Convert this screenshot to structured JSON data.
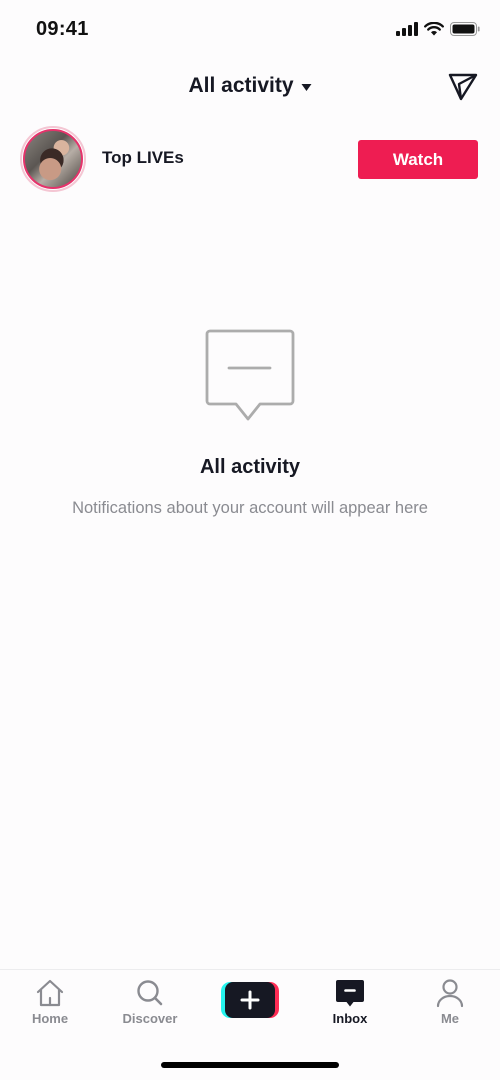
{
  "status_bar": {
    "time": "09:41",
    "icons": [
      "cellular-signal-icon",
      "wifi-icon",
      "battery-icon"
    ]
  },
  "header": {
    "title": "All activity",
    "title_dropdown_icon": "caret-down-icon",
    "action_icon": "send-direct-message-icon"
  },
  "live_row": {
    "avatar_icon": "live-user-avatar",
    "label": "Top LIVEs",
    "button_label": "Watch"
  },
  "empty_state": {
    "icon": "empty-message-icon",
    "title": "All activity",
    "subtitle": "Notifications about your account will appear here"
  },
  "tabbar": {
    "items": [
      {
        "label": "Home",
        "icon": "home-icon",
        "active": false
      },
      {
        "label": "Discover",
        "icon": "search-icon",
        "active": false
      },
      {
        "label": "",
        "icon": "create-plus-icon",
        "active": false
      },
      {
        "label": "Inbox",
        "icon": "inbox-icon",
        "active": true
      },
      {
        "label": "Me",
        "icon": "profile-icon",
        "active": false
      }
    ]
  },
  "colors": {
    "accent": "#ee1d52",
    "text_primary": "#161823",
    "text_secondary": "#8a8b91",
    "create_cyan": "#25f4ee",
    "create_pink": "#fe2c55"
  }
}
